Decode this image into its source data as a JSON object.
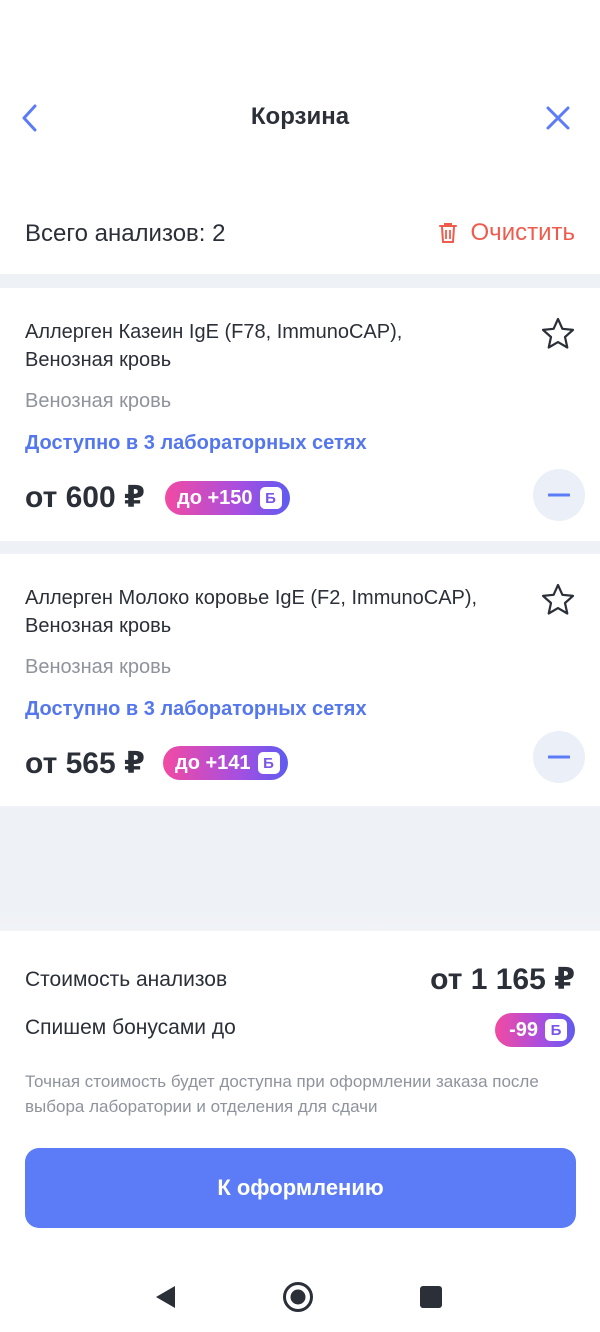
{
  "header": {
    "title": "Корзина"
  },
  "summary": {
    "total_label": "Всего анализов: 2",
    "clear_label": "Очистить"
  },
  "items": [
    {
      "name": "Аллерген Казеин IgE (F78, ImmunoCAP), Венозная кровь",
      "material": "Венозная кровь",
      "availability": "Доступно в 3 лабораторных сетях",
      "price": "от 600 ₽",
      "bonus": "до +150",
      "bonus_badge": "Б"
    },
    {
      "name": "Аллерген Молоко коровье IgE (F2, ImmunoCAP), Венозная кровь",
      "material": "Венозная кровь",
      "availability": "Доступно в 3 лабораторных сетях",
      "price": "от 565 ₽",
      "bonus": "до +141",
      "bonus_badge": "Б"
    }
  ],
  "footer": {
    "cost_label": "Стоимость анализов",
    "cost_value": "от 1 165 ₽",
    "bonus_label": "Спишем бонусами до",
    "bonus_value": "-99",
    "bonus_badge": "Б",
    "note": "Точная стоимость будет доступна при оформлении заказа после выбора лаборатории и отделения для сдачи",
    "checkout_label": "К оформлению"
  },
  "colors": {
    "accent": "#5b7cf6",
    "link": "#5577ee",
    "danger": "#ef5b4c",
    "bonus_from": "#f24aa2",
    "bonus_to": "#5f5bf0"
  },
  "icons": {
    "back": "chevron-left-icon",
    "close": "close-icon",
    "clear": "trash-icon",
    "favorite": "star-outline-icon",
    "remove": "minus-icon",
    "nav": [
      "triangle-back-icon",
      "circle-home-icon",
      "square-recents-icon"
    ]
  }
}
